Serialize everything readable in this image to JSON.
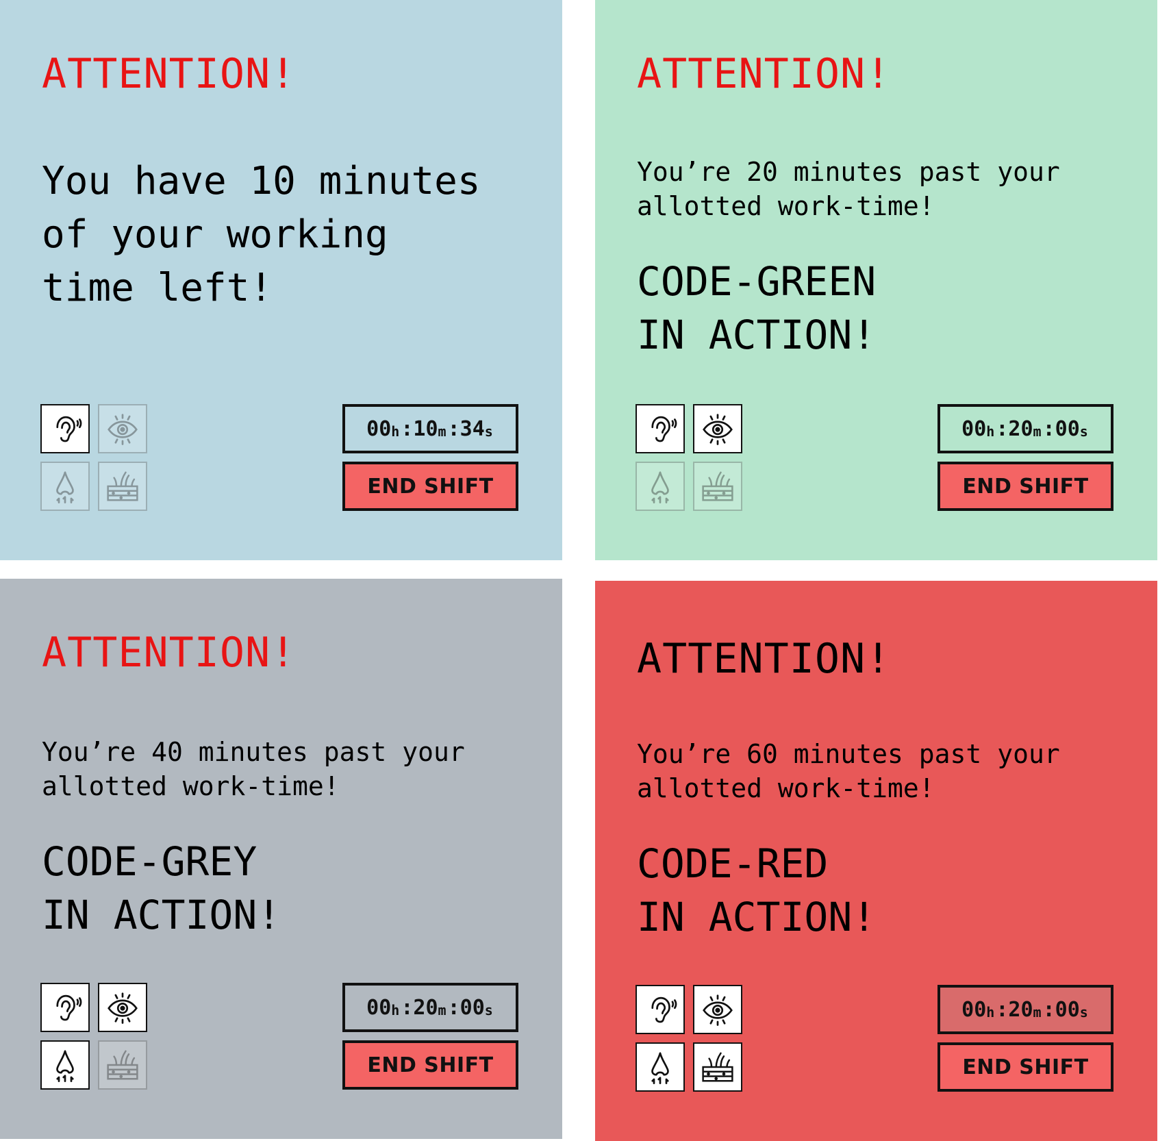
{
  "panels": [
    {
      "attention": "ATTENTION!",
      "message": "You have 10 minutes\nof your working\ntime left!",
      "code_line": "",
      "senses": {
        "ear": true,
        "eye": false,
        "nose": false,
        "skin": false
      },
      "timer": {
        "h": "00",
        "m": "10",
        "s": "34",
        "h_unit": "h",
        "m_unit": "m",
        "s_unit": "s",
        "sep": ":"
      },
      "end_shift_label": "END SHIFT",
      "background": "#b9d7e1"
    },
    {
      "attention": "ATTENTION!",
      "message": "You’re 20 minutes past your\nallotted work-time!",
      "code_line": "CODE-GREEN\nIN ACTION!",
      "senses": {
        "ear": true,
        "eye": true,
        "nose": false,
        "skin": false
      },
      "timer": {
        "h": "00",
        "m": "20",
        "s": "00",
        "h_unit": "h",
        "m_unit": "m",
        "s_unit": "s",
        "sep": ":"
      },
      "end_shift_label": "END SHIFT",
      "background": "#b5e5cc"
    },
    {
      "attention": "ATTENTION!",
      "message": "You’re 40 minutes past your\nallotted work-time!",
      "code_line": "CODE-GREY\nIN ACTION!",
      "senses": {
        "ear": true,
        "eye": true,
        "nose": true,
        "skin": false
      },
      "timer": {
        "h": "00",
        "m": "20",
        "s": "00",
        "h_unit": "h",
        "m_unit": "m",
        "s_unit": "s",
        "sep": ":"
      },
      "end_shift_label": "END SHIFT",
      "background": "#b2b9c0"
    },
    {
      "attention": "ATTENTION!",
      "message": "You’re 60 minutes past your\nallotted work-time!",
      "code_line": "CODE-RED\nIN ACTION!",
      "senses": {
        "ear": true,
        "eye": true,
        "nose": true,
        "skin": true
      },
      "timer": {
        "h": "00",
        "m": "20",
        "s": "00",
        "h_unit": "h",
        "m_unit": "m",
        "s_unit": "s",
        "sep": ":"
      },
      "end_shift_label": "END SHIFT",
      "background": "#e85858"
    }
  ],
  "colors": {
    "attention_red": "#e81414",
    "end_shift_button": "#f46464"
  },
  "icons": [
    "ear-icon",
    "eye-icon",
    "nose-icon",
    "skin-icon"
  ]
}
